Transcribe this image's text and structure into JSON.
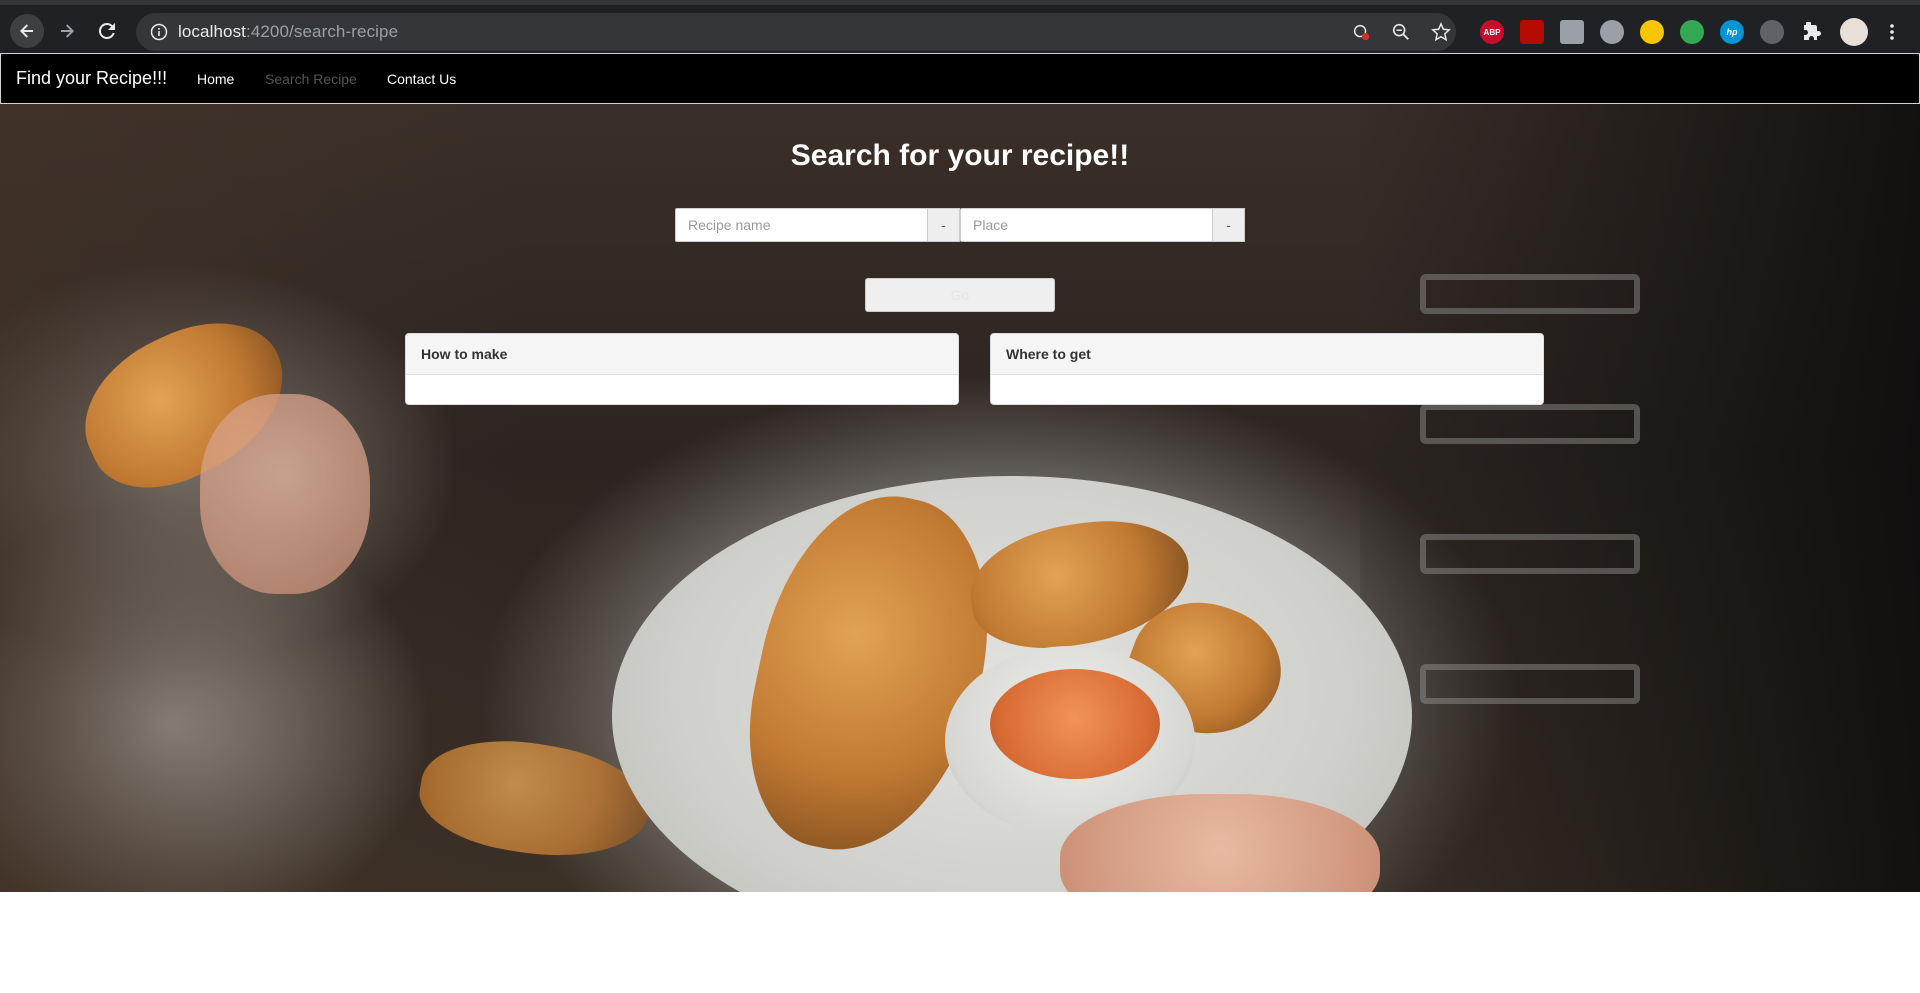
{
  "browser": {
    "url_host": "localhost",
    "url_path": ":4200/search-recipe",
    "extensions": [
      {
        "name": "adblock-plus-icon",
        "label": "ABP",
        "color": "#c70d2c"
      },
      {
        "name": "adobe-acrobat-icon",
        "label": "",
        "color": "#b30b00"
      },
      {
        "name": "tab-manager-icon",
        "label": "",
        "color": "#9aa0a6"
      },
      {
        "name": "ghostery-icon",
        "label": "",
        "color": "#9aa0a6"
      },
      {
        "name": "hand-extension-icon",
        "label": "",
        "color": "#f9c400"
      },
      {
        "name": "green-extension-icon",
        "label": "",
        "color": "#34a853"
      },
      {
        "name": "hp-extension-icon",
        "label": "hp",
        "color": "#0096d6"
      },
      {
        "name": "shield-extension-icon",
        "label": "",
        "color": "#5f6368"
      }
    ]
  },
  "navbar": {
    "brand": "Find your Recipe!!!",
    "links": [
      {
        "label": "Home",
        "active": false
      },
      {
        "label": "Search Recipe",
        "active": true
      },
      {
        "label": "Contact Us",
        "active": false
      }
    ]
  },
  "search": {
    "heading": "Search for your recipe!!",
    "recipe_placeholder": "Recipe name",
    "place_placeholder": "Place",
    "addon_label": "-",
    "go_label": "Go"
  },
  "panels": [
    {
      "title": "How to make"
    },
    {
      "title": "Where to get"
    }
  ]
}
